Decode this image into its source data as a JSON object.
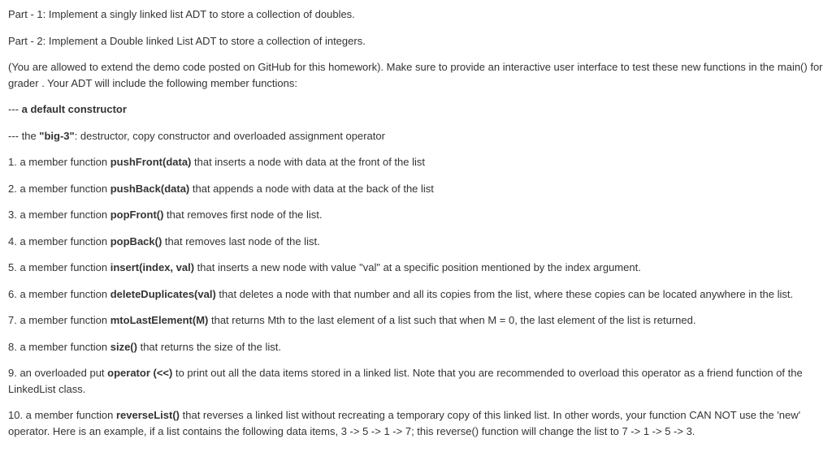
{
  "part1": "Part - 1: Implement a singly linked list ADT to store a collection of doubles.",
  "part2": "Part - 2:  Implement a Double linked List ADT to store a collection of integers.",
  "intro": "(You are allowed to extend the demo code posted on GitHub for this homework). Make sure to  provide an interactive user interface to test these new functions in the main() for grader . Your ADT will include the following member functions:",
  "ctor_pre": "--- ",
  "ctor_bold": "a default constructor",
  "big3_pre": "--- the ",
  "big3_bold": "\"big-3\"",
  "big3_post": ": destructor, copy constructor and overloaded assignment operator",
  "f1_pre": "1. a member function ",
  "f1_bold": "pushFront(data)",
  "f1_post": " that inserts a node with data at the front of the list",
  "f2_pre": "2. a member function ",
  "f2_bold": "pushBack(data)",
  "f2_post": " that appends a node with data at the back of the list",
  "f3_pre": "3. a member function ",
  "f3_bold": "popFront()",
  "f3_post": " that removes first node of the list.",
  "f4_pre": "4. a member function ",
  "f4_bold": "popBack()",
  "f4_post": " that removes last node of the list.",
  "f5_pre": "5. a member function ",
  "f5_bold": "insert(index, val)",
  "f5_post": " that inserts a new node with value \"val\" at a specific position mentioned by the index argument.",
  "f6_pre": "6. a member function ",
  "f6_bold": "deleteDuplicates(val)",
  "f6_post": " that deletes a node with that number and all its copies from the list, where these copies can be located anywhere in the list.",
  "f7_pre": "7. a member function ",
  "f7_bold": "mtoLastElement(M)",
  "f7_post": " that returns Mth to the last element of a list such that when M = 0, the last element of the list is returned.",
  "f8_pre": "8. a member function ",
  "f8_bold": "size()",
  "f8_post": " that returns the size of the list.",
  "f9_pre": "9. an overloaded put ",
  "f9_bold": "operator (<<)",
  "f9_post": " to print out all the data items stored in a linked list. Note that you are recommended to overload this operator as a friend function of the LinkedList class.",
  "f10_pre": "10. a member function ",
  "f10_bold": "reverseList()",
  "f10_post": " that reverses a linked list without recreating a temporary copy of this linked list. In other words, your function CAN NOT use the 'new' operator. Here is an example, if a list contains the following data items, 3 -> 5 -> 1 -> 7; this reverse() function will change the list to 7 -> 1 -> 5 -> 3."
}
